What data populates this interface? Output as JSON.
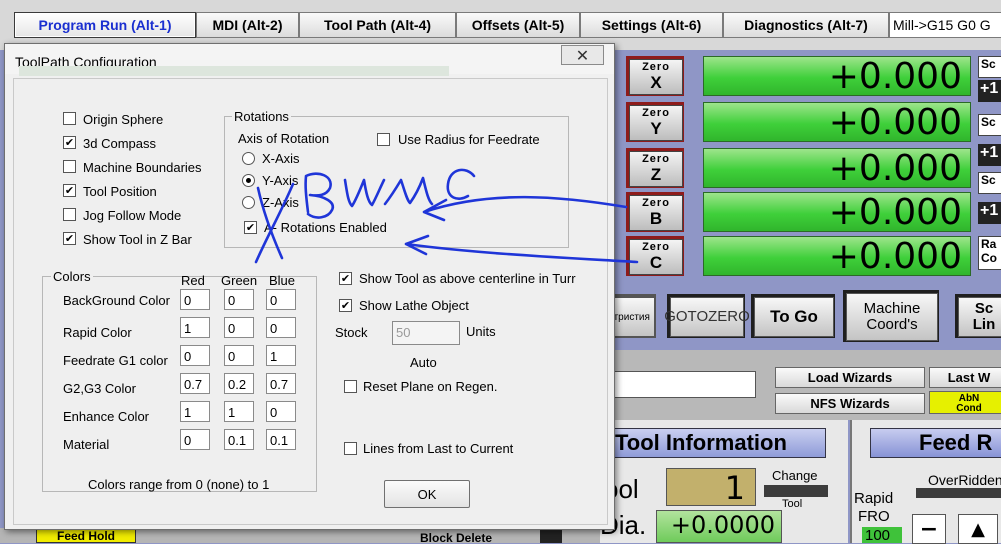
{
  "tabs": [
    "Program Run (Alt-1)",
    "MDI (Alt-2)",
    "Tool Path (Alt-4)",
    "Offsets (Alt-5)",
    "Settings (Alt-6)",
    "Diagnostics (Alt-7)"
  ],
  "mode_line": "Mill->G15  G0 G",
  "axes": [
    {
      "zero_top": "Zero",
      "zero_axis": "X",
      "dro": "+0.000",
      "side": "Sc"
    },
    {
      "zero_top": "Zero",
      "zero_axis": "Y",
      "dro": "+0.000",
      "side": "Sc"
    },
    {
      "zero_top": "Zero",
      "zero_axis": "Z",
      "dro": "+0.000",
      "side": "Sc"
    },
    {
      "zero_top": "Zero",
      "zero_axis": "B",
      "dro": "+0.000",
      "side": "+1"
    },
    {
      "zero_top": "Zero",
      "zero_axis": "C",
      "dro": "+0.000",
      "side": "Ra"
    }
  ],
  "side_labels": [
    "+1",
    "+1",
    "+1",
    "Co"
  ],
  "buttons": {
    "partial_left": [
      "нтр",
      "истия"
    ],
    "goto_zero": [
      "GOTO",
      "ZERO"
    ],
    "to_go": "To Go",
    "machine_coords": [
      "Machine",
      "Coord's"
    ],
    "partial_right": [
      "Sc",
      "Lin"
    ]
  },
  "wizards": {
    "load": "Load Wizards",
    "nfs": "NFS Wizards",
    "last": "Last W",
    "abnormal": [
      "AbN",
      "Cond"
    ]
  },
  "tool_info": {
    "heading": "Tool Information",
    "tool_label": "ool",
    "tool_number": "1",
    "change": "Change",
    "tool_small": "Tool",
    "dia_label": "Dia.",
    "dia_value": "+0.0000"
  },
  "feed": {
    "heading": "Feed R",
    "overridden": "OverRidden",
    "rapid": "Rapid",
    "fro": "FRO",
    "fro_value": "100"
  },
  "bottom": {
    "feed_hold": "Feed Hold",
    "block_delete": "Block Delete"
  },
  "dialog": {
    "title": "ToolPath Configuration",
    "checkboxes": [
      {
        "label": "Origin Sphere",
        "checked": false
      },
      {
        "label": "3d Compass",
        "checked": true
      },
      {
        "label": "Machine Boundaries",
        "checked": false
      },
      {
        "label": "Tool Position",
        "checked": true
      },
      {
        "label": "Jog Follow Mode",
        "checked": false
      },
      {
        "label": "Show Tool in Z Bar",
        "checked": true
      }
    ],
    "rotations": {
      "legend": "Rotations",
      "axis_label": "Axis of Rotation",
      "use_radius": "Use Radius for Feedrate",
      "options": [
        "X-Axis",
        "Y-Axis",
        "Z-Axis"
      ],
      "selected": "Y-Axis",
      "a_enabled": "A- Rotations Enabled",
      "a_checked": true
    },
    "colors": {
      "legend": "Colors",
      "headers": [
        "Red",
        "Green",
        "Blue"
      ],
      "rows": [
        {
          "name": "BackGround Color",
          "values": [
            "0",
            "0",
            "0"
          ]
        },
        {
          "name": "Rapid Color",
          "values": [
            "1",
            "0",
            "0"
          ]
        },
        {
          "name": "Feedrate G1 color",
          "values": [
            "0",
            "0",
            "1"
          ]
        },
        {
          "name": "G2,G3 Color",
          "values": [
            "0.7",
            "0.2",
            "0.7"
          ]
        },
        {
          "name": "Enhance Color",
          "values": [
            "1",
            "1",
            "0"
          ]
        },
        {
          "name": "Material",
          "values": [
            "0",
            "0.1",
            "0.1"
          ]
        }
      ],
      "note": "Colors range from 0 (none) to 1"
    },
    "right": {
      "show_tool_above": "Show Tool as above centerline in Turr",
      "show_lathe": "Show Lathe Object",
      "stock_label": "Stock",
      "stock_value": "50",
      "units": "Units",
      "auto": "Auto",
      "reset_plane": "Reset Plane on Regen.",
      "lines_from_last": "Lines from Last to Current"
    },
    "ok": "OK"
  },
  "annotation": {
    "text": "В или С",
    "color": "#1f35d8"
  }
}
